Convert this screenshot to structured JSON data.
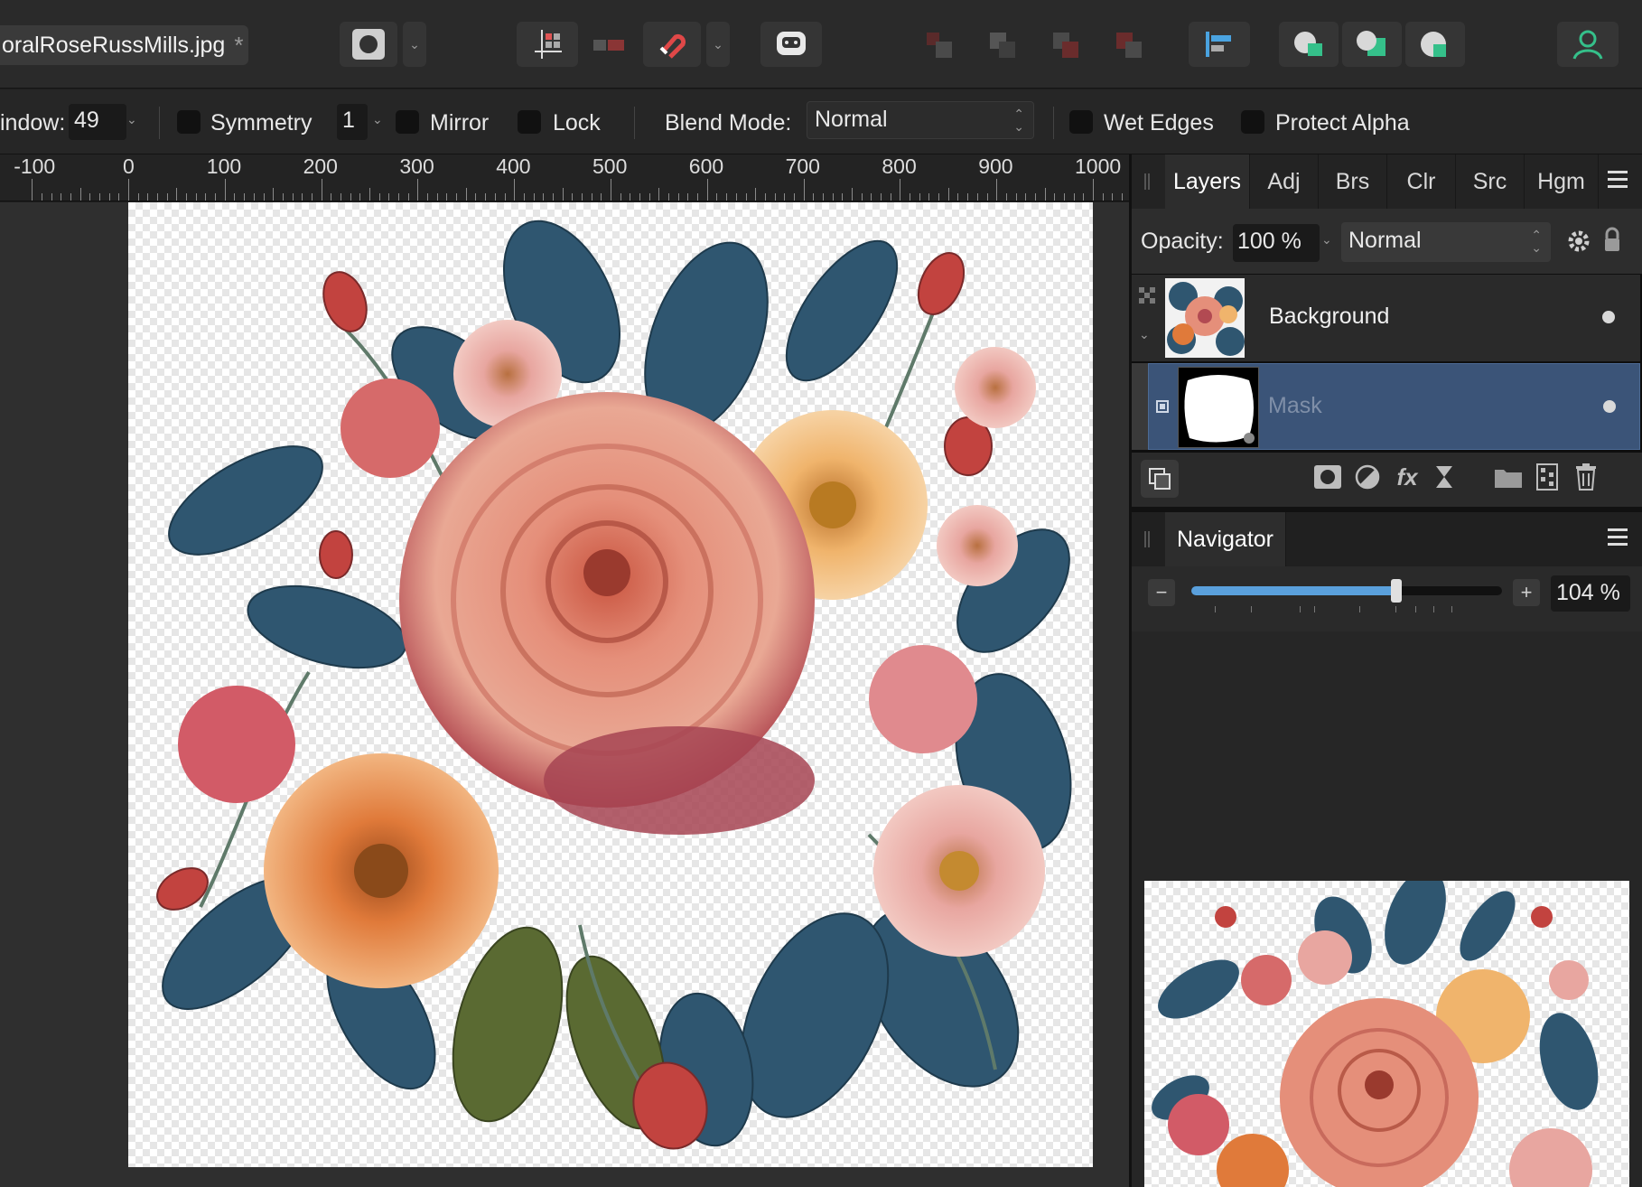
{
  "document": {
    "filename": "oralRoseRussMills.jpg",
    "modified_marker": "*"
  },
  "toolbar": {
    "icons": [
      "brush-mode-icon",
      "dropdown-icon",
      "snapping-icon",
      "assistant-icon",
      "magnet-icon",
      "dropdown-icon",
      "pixel-persona-icon",
      "arrange-back-icon",
      "arrange-backward-icon",
      "arrange-forward-icon",
      "arrange-front-icon",
      "align-icon",
      "insert-inside-icon",
      "insert-behind-icon",
      "insert-top-icon",
      "account-icon"
    ]
  },
  "context": {
    "window_label": "indow:",
    "window_value": "49",
    "symmetry_label": "Symmetry",
    "symmetry_value": "1",
    "mirror_label": "Mirror",
    "lock_label": "Lock",
    "blend_mode_label": "Blend Mode:",
    "blend_mode_value": "Normal",
    "wet_edges_label": "Wet Edges",
    "protect_alpha_label": "Protect Alpha"
  },
  "ruler": {
    "labels": [
      "-100",
      "0",
      "100",
      "200",
      "300",
      "400",
      "500",
      "600",
      "700",
      "800",
      "900",
      "1000"
    ]
  },
  "layers_panel": {
    "tabs": [
      "Layers",
      "Adj",
      "Brs",
      "Clr",
      "Src",
      "Hgm"
    ],
    "active_tab": "Layers",
    "opacity_label": "Opacity:",
    "opacity_value": "100 %",
    "blend_value": "Normal",
    "layers": [
      {
        "name": "Background",
        "visible": true,
        "selected": false
      },
      {
        "name": "Mask",
        "visible": true,
        "selected": true
      }
    ]
  },
  "navigator": {
    "title": "Navigator",
    "zoom_value": "104 %",
    "zoom_slider_fraction": 0.66
  },
  "colors": {
    "selection": "#3b5478",
    "accent_green": "#35c08a"
  }
}
